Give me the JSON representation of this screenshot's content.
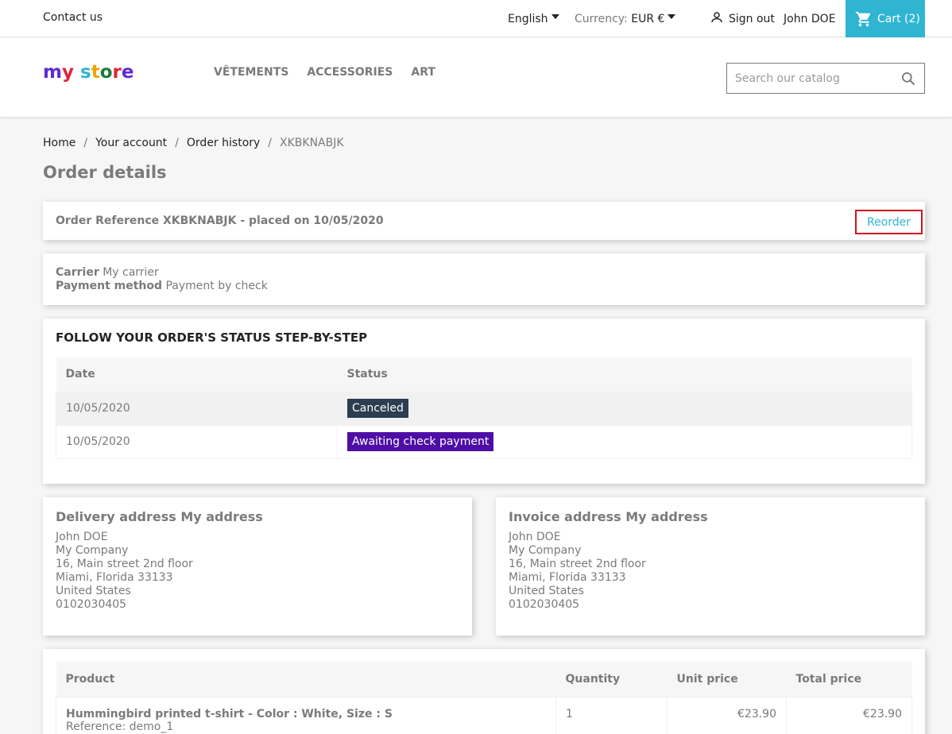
{
  "topbar": {
    "contact": "Contact us",
    "language": "English",
    "currency_label": "Currency:",
    "currency_value": "EUR €",
    "sign_out": "Sign out",
    "user_name": "John DOE",
    "cart": "Cart (2)"
  },
  "header": {
    "logo_letters": [
      "m",
      "y",
      " ",
      "s",
      "t",
      "o",
      "r",
      "e"
    ],
    "logo_colors": [
      "#5c2bd6",
      "#e0233a",
      "#ffffff",
      "#2fb5d2",
      "#f0a400",
      "#1a7a3a",
      "#e0233a",
      "#5c2bd6"
    ],
    "nav": [
      "VÊTEMENTS",
      "ACCESSORIES",
      "ART"
    ],
    "search_placeholder": "Search our catalog"
  },
  "breadcrumb": [
    "Home",
    "Your account",
    "Order history",
    "XKBKNABJK"
  ],
  "page_title": "Order details",
  "order": {
    "reference_text": "Order Reference XKBKNABJK - placed on 10/05/2020",
    "reorder": "Reorder",
    "carrier_label": "Carrier",
    "carrier_value": "My carrier",
    "payment_label": "Payment method",
    "payment_value": "Payment by check"
  },
  "status_section": {
    "title": "FOLLOW YOUR ORDER'S STATUS STEP-BY-STEP",
    "headers": [
      "Date",
      "Status"
    ],
    "rows": [
      {
        "date": "10/05/2020",
        "status": "Canceled",
        "color": "#2c3e50"
      },
      {
        "date": "10/05/2020",
        "status": "Awaiting check payment",
        "color": "#4e0ea6"
      }
    ]
  },
  "delivery": {
    "title": "Delivery address My address",
    "lines": [
      "John DOE",
      "My Company",
      "16, Main street 2nd floor",
      "Miami, Florida 33133",
      "United States",
      "0102030405"
    ]
  },
  "invoice": {
    "title": "Invoice address My address",
    "lines": [
      "John DOE",
      "My Company",
      "16, Main street 2nd floor",
      "Miami, Florida 33133",
      "United States",
      "0102030405"
    ]
  },
  "products": {
    "headers": [
      "Product",
      "Quantity",
      "Unit price",
      "Total price"
    ],
    "rows": [
      {
        "name": "Hummingbird printed t-shirt - Color : White, Size : S",
        "reference": "Reference: demo_1",
        "quantity": "1",
        "unit_price": "€23.90",
        "total_price": "€23.90"
      }
    ]
  }
}
